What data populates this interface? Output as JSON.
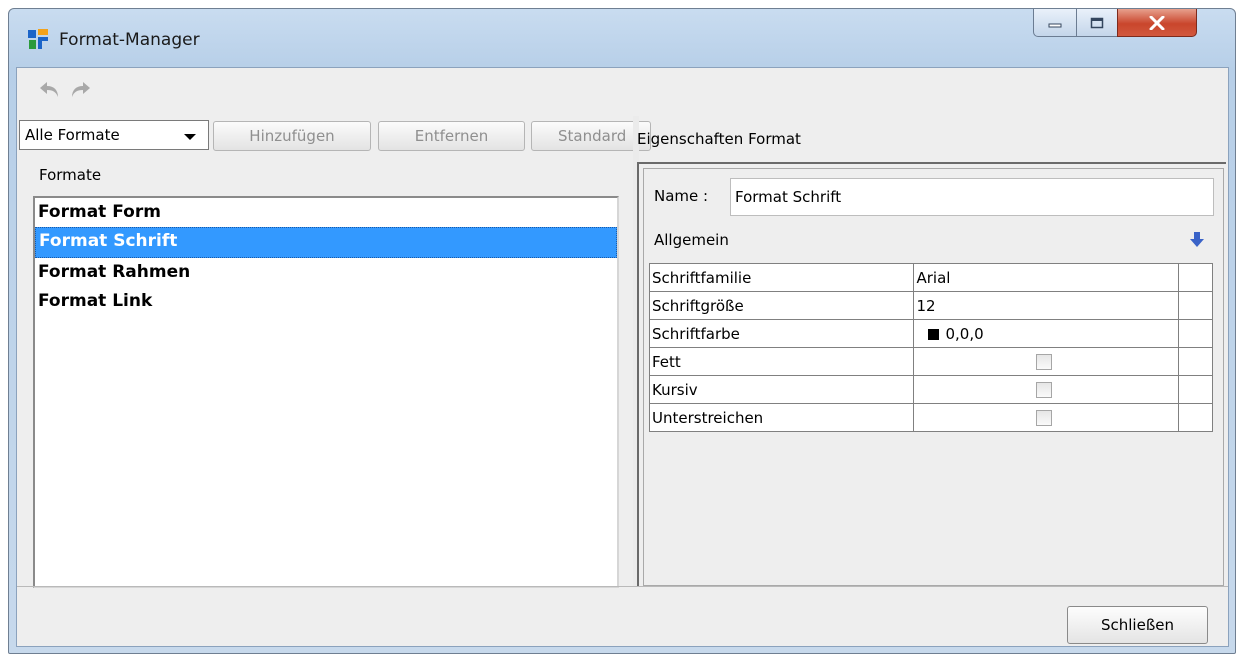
{
  "window": {
    "title": "Format-Manager",
    "controls": {
      "minimize": "minimize-icon",
      "maximize": "maximize-icon",
      "close": "close-icon"
    }
  },
  "toolbar": {
    "undo": "undo-icon",
    "redo": "redo-icon"
  },
  "left": {
    "filter": {
      "selected": "Alle Formate"
    },
    "buttons": {
      "add": "Hinzufügen",
      "remove": "Entfernen",
      "default": "Standard"
    },
    "list_label": "Formate",
    "items": [
      {
        "label": "Format Form",
        "selected": false
      },
      {
        "label": "Format Schrift",
        "selected": true
      },
      {
        "label": "Format Rahmen",
        "selected": false
      },
      {
        "label": "Format Link",
        "selected": false
      }
    ]
  },
  "right": {
    "title": "Eigenschaften Format",
    "name_label": "Name :",
    "name_value": "Format Schrift",
    "section_label": "Allgemein",
    "properties": [
      {
        "name": "Schriftfamilie",
        "value": "Arial"
      },
      {
        "name": "Schriftgröße",
        "value": "12"
      },
      {
        "name": "Schriftfarbe",
        "value": "0,0,0",
        "swatch": "#000000"
      },
      {
        "name": "Fett",
        "checked": false
      },
      {
        "name": "Kursiv",
        "checked": false
      },
      {
        "name": "Unterstreichen",
        "checked": false
      }
    ]
  },
  "footer": {
    "close_label": "Schließen"
  },
  "colors": {
    "selection": "#3399ff",
    "client_bg": "#eeeeee",
    "close_button": "#c9462c"
  }
}
